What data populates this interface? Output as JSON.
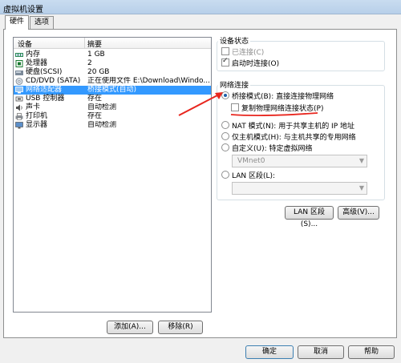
{
  "window": {
    "title": "虚拟机设置"
  },
  "tabs": [
    {
      "label": "硬件",
      "active": true
    },
    {
      "label": "选项",
      "active": false
    }
  ],
  "device_list": {
    "headers": {
      "device": "设备",
      "summary": "摘要"
    },
    "rows": [
      {
        "icon": "memory-icon",
        "name": "内存",
        "summary": "1 GB",
        "selected": false
      },
      {
        "icon": "cpu-icon",
        "name": "处理器",
        "summary": "2",
        "selected": false
      },
      {
        "icon": "harddisk-icon",
        "name": "硬盘(SCSI)",
        "summary": "20 GB",
        "selected": false
      },
      {
        "icon": "cd-dvd-icon",
        "name": "CD/DVD (SATA)",
        "summary": "正在使用文件 E:\\Download\\Windo...",
        "selected": false
      },
      {
        "icon": "network-adapter-icon",
        "name": "网络适配器",
        "summary": "桥接模式(自动)",
        "selected": true
      },
      {
        "icon": "usb-icon",
        "name": "USB 控制器",
        "summary": "存在",
        "selected": false
      },
      {
        "icon": "sound-icon",
        "name": "声卡",
        "summary": "自动检测",
        "selected": false
      },
      {
        "icon": "printer-icon",
        "name": "打印机",
        "summary": "存在",
        "selected": false
      },
      {
        "icon": "display-icon",
        "name": "显示器",
        "summary": "自动检测",
        "selected": false
      }
    ]
  },
  "device_status": {
    "title": "设备状态",
    "connected": {
      "label": "已连接(C)",
      "checked": false,
      "enabled": false
    },
    "connect_at_power_on": {
      "label": "启动时连接(O)",
      "checked": true,
      "enabled": true
    }
  },
  "network_connection": {
    "title": "网络连接",
    "bridged": {
      "label": "桥接模式(B): 直接连接物理网络",
      "checked": true
    },
    "replicate": {
      "label": "复制物理网络连接状态(P)",
      "checked": false
    },
    "nat": {
      "label": "NAT 模式(N): 用于共享主机的 IP 地址",
      "checked": false
    },
    "host_only": {
      "label": "仅主机模式(H): 与主机共享的专用网络",
      "checked": false
    },
    "custom": {
      "label": "自定义(U): 特定虚拟网络",
      "checked": false
    },
    "custom_select": {
      "value": "VMnet0"
    },
    "lan_segment": {
      "label": "LAN 区段(L):",
      "checked": false
    },
    "lan_select": {
      "value": ""
    }
  },
  "buttons": {
    "lan_segments": "LAN 区段(S)...",
    "advanced": "高级(V)...",
    "add": "添加(A)...",
    "remove": "移除(R)",
    "ok": "确定",
    "cancel": "取消",
    "help": "帮助"
  },
  "annotation": {
    "arrow_color": "#e8261e",
    "underline_color": "#e8261e"
  }
}
